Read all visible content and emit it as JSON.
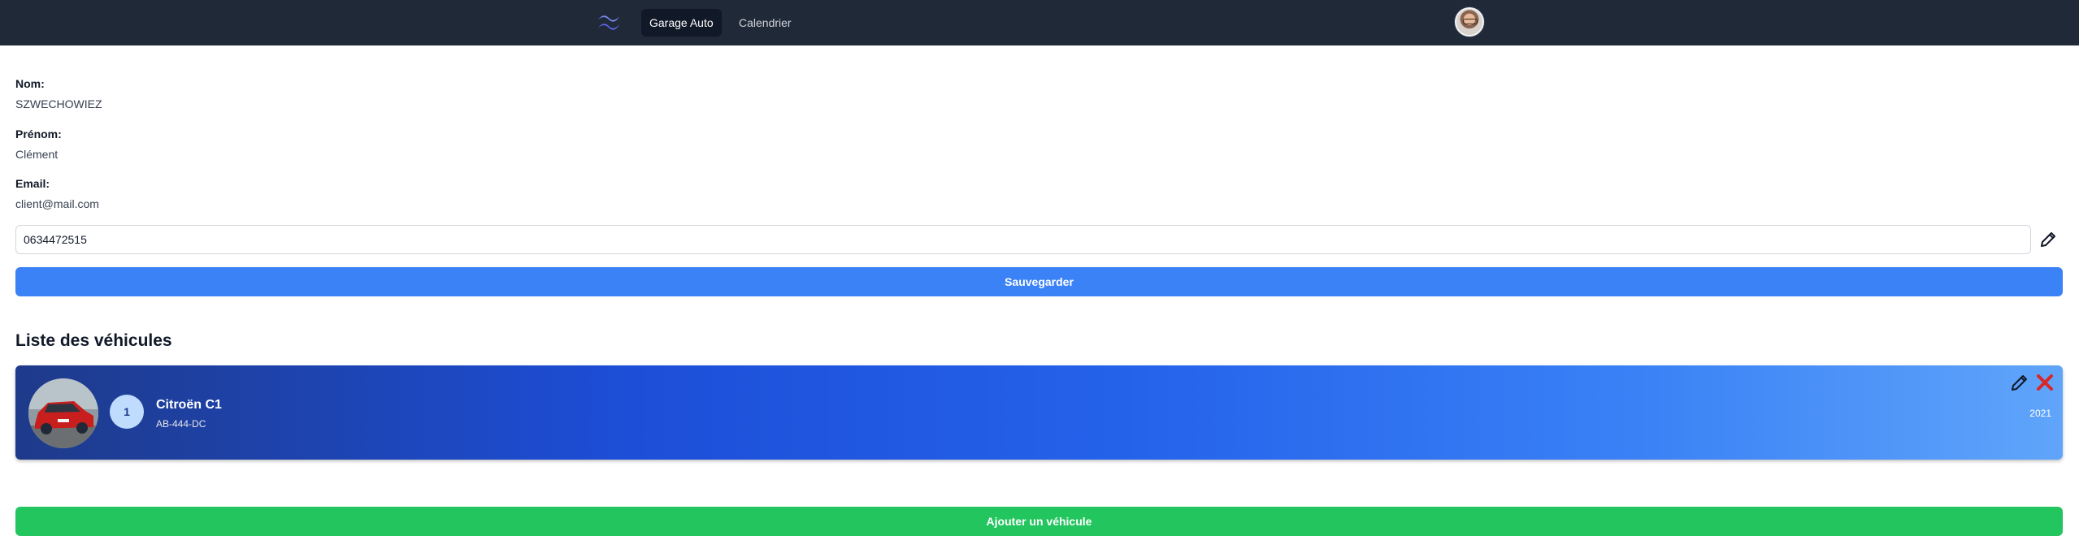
{
  "nav": {
    "logo_icon": "tailwind-wave-icon",
    "items": [
      {
        "label": "Garage Auto",
        "active": true
      },
      {
        "label": "Calendrier",
        "active": false
      }
    ],
    "avatar_icon": "user-avatar"
  },
  "profile": {
    "nom_label": "Nom:",
    "nom_value": "SZWECHOWIEZ",
    "prenom_label": "Prénom:",
    "prenom_value": "Clément",
    "email_label": "Email:",
    "email_value": "client@mail.com",
    "phone_value": "0634472515",
    "edit_icon": "pencil-icon",
    "save_label": "Sauvegarder"
  },
  "vehicles": {
    "title": "Liste des véhicules",
    "items": [
      {
        "index": "1",
        "model": "Citroën C1",
        "plate": "AB-444-DC",
        "year": "2021",
        "photo_icon": "red-car-photo",
        "edit_icon": "pencil-icon",
        "delete_icon": "close-icon"
      }
    ],
    "add_label": "Ajouter un véhicule"
  },
  "colors": {
    "navbar": "#1f2937",
    "primary": "#3b82f6",
    "success": "#22c55e",
    "danger": "#dc2626"
  }
}
